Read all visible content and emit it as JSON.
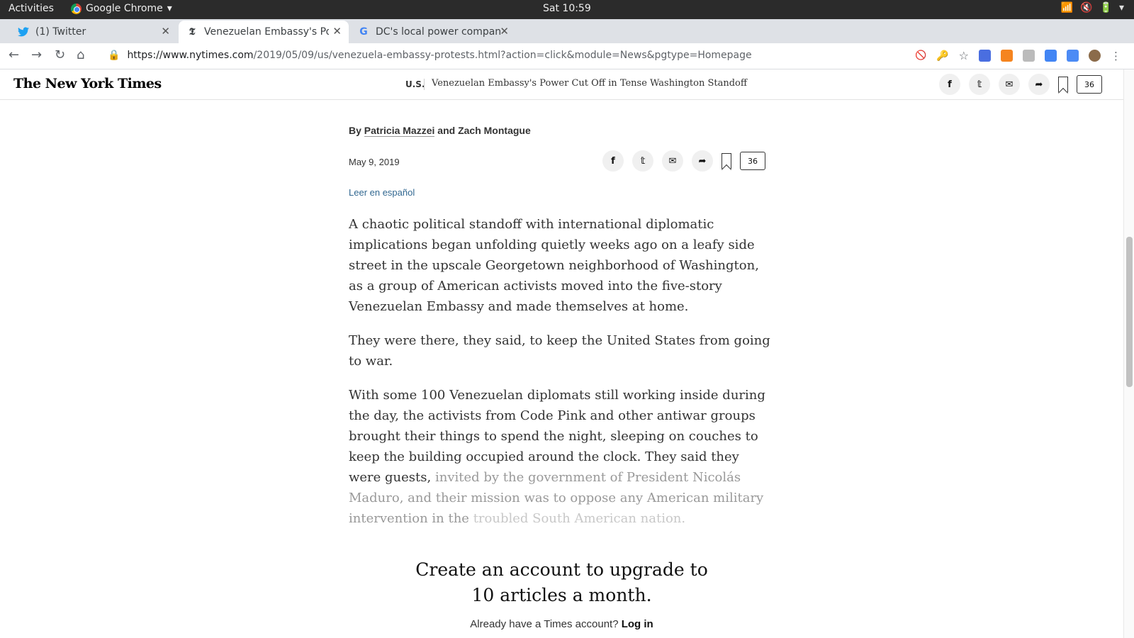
{
  "system": {
    "activities": "Activities",
    "app_name": "Google Chrome",
    "clock": "Sat 10:59"
  },
  "tabs": [
    {
      "title": "(1) Twitter"
    },
    {
      "title": "Venezuelan Embassy's Po"
    },
    {
      "title": "DC's local power compan"
    }
  ],
  "address": {
    "host": "https://www.nytimes.com",
    "path": "/2019/05/09/us/venezuela-embassy-protests.html?action=click&module=News&pgtype=Homepage"
  },
  "nyt": {
    "logo": "The New York Times",
    "section": "U.S.",
    "headline": "Venezuelan Embassy's Power Cut Off in Tense Washington Standoff",
    "comment_count": "36"
  },
  "article": {
    "byline_prefix": "By",
    "author1": "Patricia Mazzei",
    "byline_and": "and",
    "author2": "Zach Montague",
    "date": "May 9, 2019",
    "spanish_link": "Leer en español",
    "comment_count": "36",
    "p1": "A chaotic political standoff with international diplomatic implications began unfolding quietly weeks ago on a leafy side street in the upscale Georgetown neighborhood of Washington, as a group of American activists moved into the five-story Venezuelan Embassy and made themselves at home.",
    "p2": "They were there, they said, to keep the United States from going to war.",
    "p3a": "With some 100 Venezuelan diplomats still working inside during the day, the activists from Code Pink and other antiwar groups brought their things to spend the night, sleeping on couches to keep the building occupied around the clock. They said they were guests,",
    "p3b": "invited by the government of President Nicolás Maduro, and their mission was to oppose any American military intervention in the",
    "p3c": "troubled South American nation."
  },
  "paywall": {
    "line1": "Create an account to upgrade to",
    "line2": "10 articles a month.",
    "login_prompt": "Already have a Times account?",
    "login_link": "Log in"
  },
  "colors": {
    "link": "#326891",
    "chrome_tabstrip": "#dee1e6",
    "topbar": "#2b2b2b"
  }
}
